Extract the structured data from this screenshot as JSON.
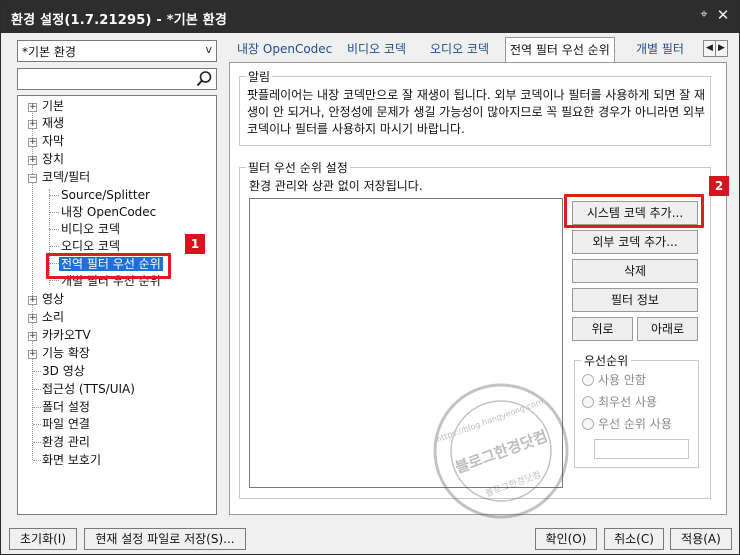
{
  "window": {
    "title": "환경 설정(1.7.21295) - *기본 환경",
    "pin_glyph": "⌖",
    "close_glyph": "✕"
  },
  "preset": {
    "value": "*기본 환경",
    "arrow": "v"
  },
  "search": {
    "value": "",
    "icon": "search-icon"
  },
  "tree": {
    "items": [
      {
        "label": "기본",
        "expander": "+"
      },
      {
        "label": "재생",
        "expander": "+"
      },
      {
        "label": "자막",
        "expander": "+"
      },
      {
        "label": "장치",
        "expander": "+"
      },
      {
        "label": "코덱/필터",
        "expander": "−"
      },
      {
        "label": "Source/Splitter"
      },
      {
        "label": "내장 OpenCodec"
      },
      {
        "label": "비디오 코덱"
      },
      {
        "label": "오디오 코덱"
      },
      {
        "label": "전역 필터 우선 순위",
        "selected": true
      },
      {
        "label": "개별 필터 우선 순위"
      },
      {
        "label": "영상",
        "expander": "+"
      },
      {
        "label": "소리",
        "expander": "+"
      },
      {
        "label": "카카오TV",
        "expander": "+"
      },
      {
        "label": "기능 확장",
        "expander": "+"
      },
      {
        "label": "3D 영상"
      },
      {
        "label": "접근성 (TTS/UIA)"
      },
      {
        "label": "폴더 설정"
      },
      {
        "label": "파일 연결"
      },
      {
        "label": "환경 관리"
      },
      {
        "label": "화면 보호기"
      }
    ]
  },
  "tabs": [
    {
      "label": "내장 OpenCodec"
    },
    {
      "label": "비디오 코덱"
    },
    {
      "label": "오디오 코덱"
    },
    {
      "label": "전역 필터 우선 순위",
      "active": true
    },
    {
      "label": "개별 필터"
    }
  ],
  "tab_scroll": {
    "left": "◀",
    "right": "▶"
  },
  "notice": {
    "legend": "알림",
    "text": "팟플레이어는 내장 코덱만으로 잘 재생이 됩니다. 외부 코덱이나 필터를 사용하게 되면 잘 재생이 안 되거나, 안정성에 문제가 생길 가능성이 많아지므로 꼭 필요한 경우가 아니라면 외부 코덱이나 필터를 사용하지 마시기 바랍니다."
  },
  "filter_priority": {
    "legend": "필터 우선 순위 설정",
    "description": "환경 관리와 상관 없이 저장됩니다.",
    "buttons": {
      "add_system_codec": "시스템 코덱 추가...",
      "add_external_codec": "외부 코덱 추가...",
      "delete": "삭제",
      "filter_info": "필터 정보",
      "up": "위로",
      "down": "아래로"
    },
    "priority": {
      "legend": "우선순위",
      "options": [
        "사용 안함",
        "최우선 사용",
        "우선 순위 사용"
      ],
      "value": ""
    }
  },
  "callouts": [
    {
      "number": "1"
    },
    {
      "number": "2"
    }
  ],
  "watermark": {
    "top_text": "https://blog.hangyeong.com",
    "main": "블로그한경닷컴",
    "bottom_text": "블로그한경닷컴"
  },
  "footer": {
    "reset": "초기화(I)",
    "save_to_file": "현재 설정 파일로 저장(S)...",
    "ok": "확인(O)",
    "cancel": "취소(C)",
    "apply": "적용(A)"
  },
  "colors": {
    "titlebar": "#2d2d2d",
    "selection": "#1e6fd9",
    "callout": "#e21b1b",
    "badge": "#d8141f"
  }
}
